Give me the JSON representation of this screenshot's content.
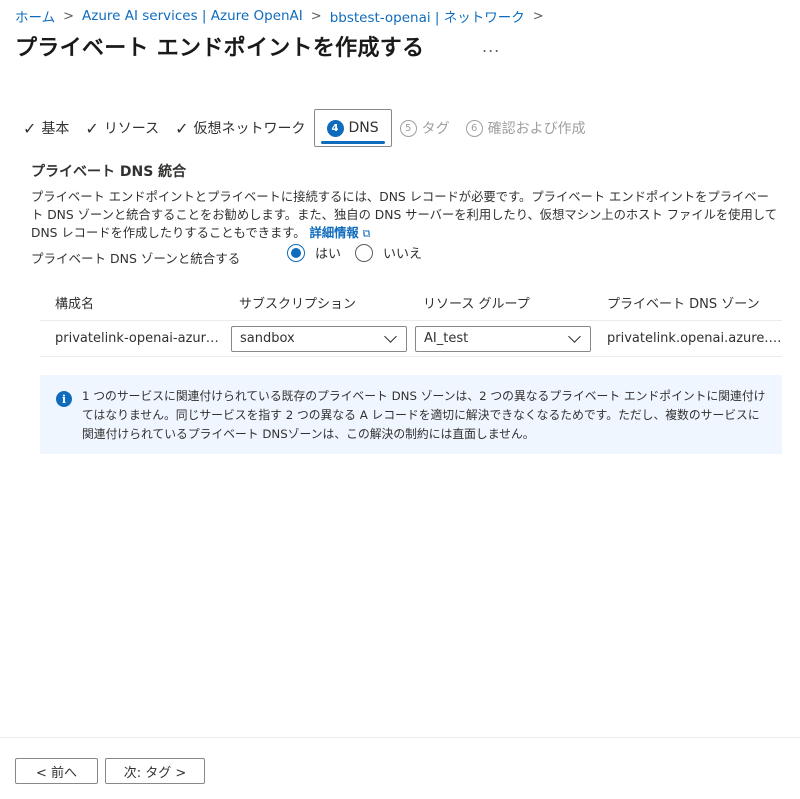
{
  "breadcrumb": [
    "ホーム",
    "Azure AI services | Azure OpenAI",
    "bbstest-openai | ネットワーク"
  ],
  "page_title": "プライベート エンドポイントを作成する",
  "more_label": "...",
  "tabs": [
    {
      "label": "基本",
      "state": "done"
    },
    {
      "label": "リソース",
      "state": "done"
    },
    {
      "label": "仮想ネットワーク",
      "state": "done"
    },
    {
      "num": "4",
      "label": "DNS",
      "state": "active"
    },
    {
      "num": "5",
      "label": "タグ",
      "state": "disabled"
    },
    {
      "num": "6",
      "label": "確認および作成",
      "state": "disabled"
    }
  ],
  "section": {
    "title": "プライベート DNS 統合",
    "description": "プライベート エンドポイントとプライベートに接続するには、DNS レコードが必要です。プライベート エンドポイントをプライベート DNS ゾーンと統合することをお勧めします。また、独自の DNS サーバーを利用したり、仮想マシン上のホスト ファイルを使用して DNS レコードを作成したりすることもできます。",
    "learn_more": "詳細情報",
    "integrate_label": "プライベート DNS ゾーンと統合する",
    "yes": "はい",
    "no": "いいえ",
    "selected": "yes"
  },
  "grid": {
    "headers": [
      "構成名",
      "サブスクリプション",
      "リソース グループ",
      "プライベート DNS ゾーン"
    ],
    "rows": [
      {
        "config": "privatelink-openai-azure-com",
        "subscription": "sandbox",
        "resource_group": "AI_test",
        "zone": "privatelink.openai.azure.com"
      }
    ]
  },
  "info": "1 つのサービスに関連付けられている既存のプライベート DNS ゾーンは、2 つの異なるプライベート エンドポイントに関連付けてはなりません。同じサービスを指す 2 つの異なる A レコードを適切に解決できなくなるためです。ただし、複数のサービスに関連付けられているプライベート DNSゾーンは、この解決の制約には直面しません。",
  "footer": {
    "prev": "< 前へ",
    "next": "次: タグ >"
  },
  "colors": {
    "accent": "#0f6cbd",
    "info_bg": "#f0f6ff"
  }
}
